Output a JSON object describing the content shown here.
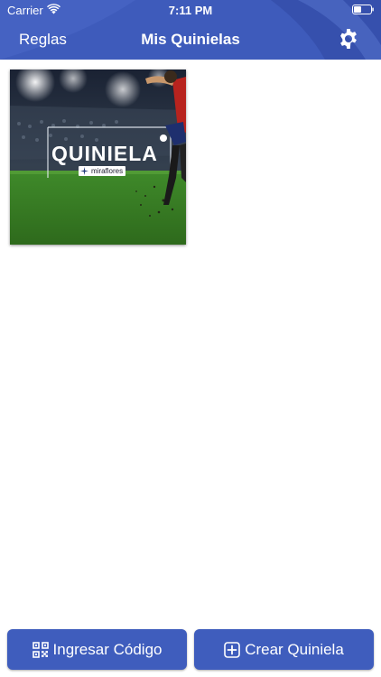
{
  "status_bar": {
    "carrier": "Carrier",
    "time": "7:11 PM"
  },
  "nav": {
    "left_label": "Reglas",
    "title": "Mis Quinielas",
    "right_icon": "gear-icon"
  },
  "quinielas": [
    {
      "title": "QUINIELA",
      "sponsor": "miraflores"
    }
  ],
  "actions": {
    "enter_code_label": "Ingresar Código",
    "enter_code_icon": "qr-code-icon",
    "create_label": "Crear Quiniela",
    "create_icon": "plus-square-icon"
  },
  "colors": {
    "brand": "#3f5dbd",
    "background": "#ffffff"
  }
}
